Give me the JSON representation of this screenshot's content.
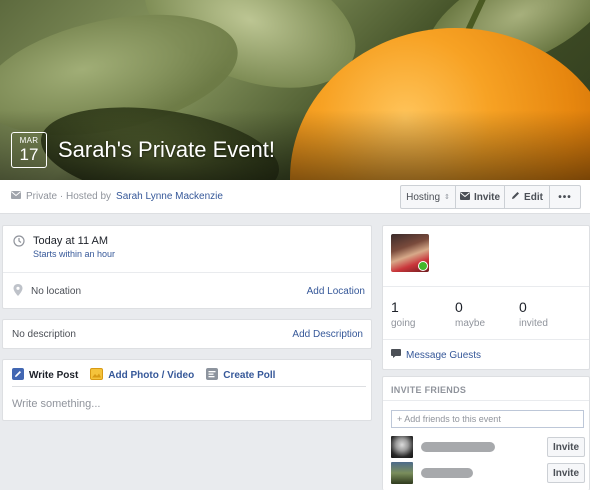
{
  "cover": {
    "date_month": "MAR",
    "date_day": "17",
    "event_title": "Sarah's Private Event!"
  },
  "infobar": {
    "privacy": "Private · Hosted by",
    "host_name": "Sarah Lynne Mackenzie",
    "buttons": {
      "hosting": "Hosting",
      "invite": "Invite",
      "edit": "Edit",
      "more": "•••"
    }
  },
  "details": {
    "time": "Today at 11 AM",
    "time_sub": "Starts within an hour",
    "location": "No location",
    "add_location": "Add Location"
  },
  "description": {
    "text": "No description",
    "add": "Add Description"
  },
  "composer": {
    "tabs": {
      "write": "Write Post",
      "photo": "Add Photo / Video",
      "poll": "Create Poll"
    },
    "placeholder": "Write something..."
  },
  "guests": {
    "counts": [
      {
        "n": "1",
        "label": "going"
      },
      {
        "n": "0",
        "label": "maybe"
      },
      {
        "n": "0",
        "label": "invited"
      }
    ],
    "message": "Message Guests"
  },
  "invite_friends": {
    "header": "INVITE FRIENDS",
    "placeholder": "+ Add friends to this event",
    "invite_label": "Invite"
  },
  "colors": {
    "link": "#365899",
    "background": "#e9ebee",
    "accent_orange": "#f7a224"
  }
}
